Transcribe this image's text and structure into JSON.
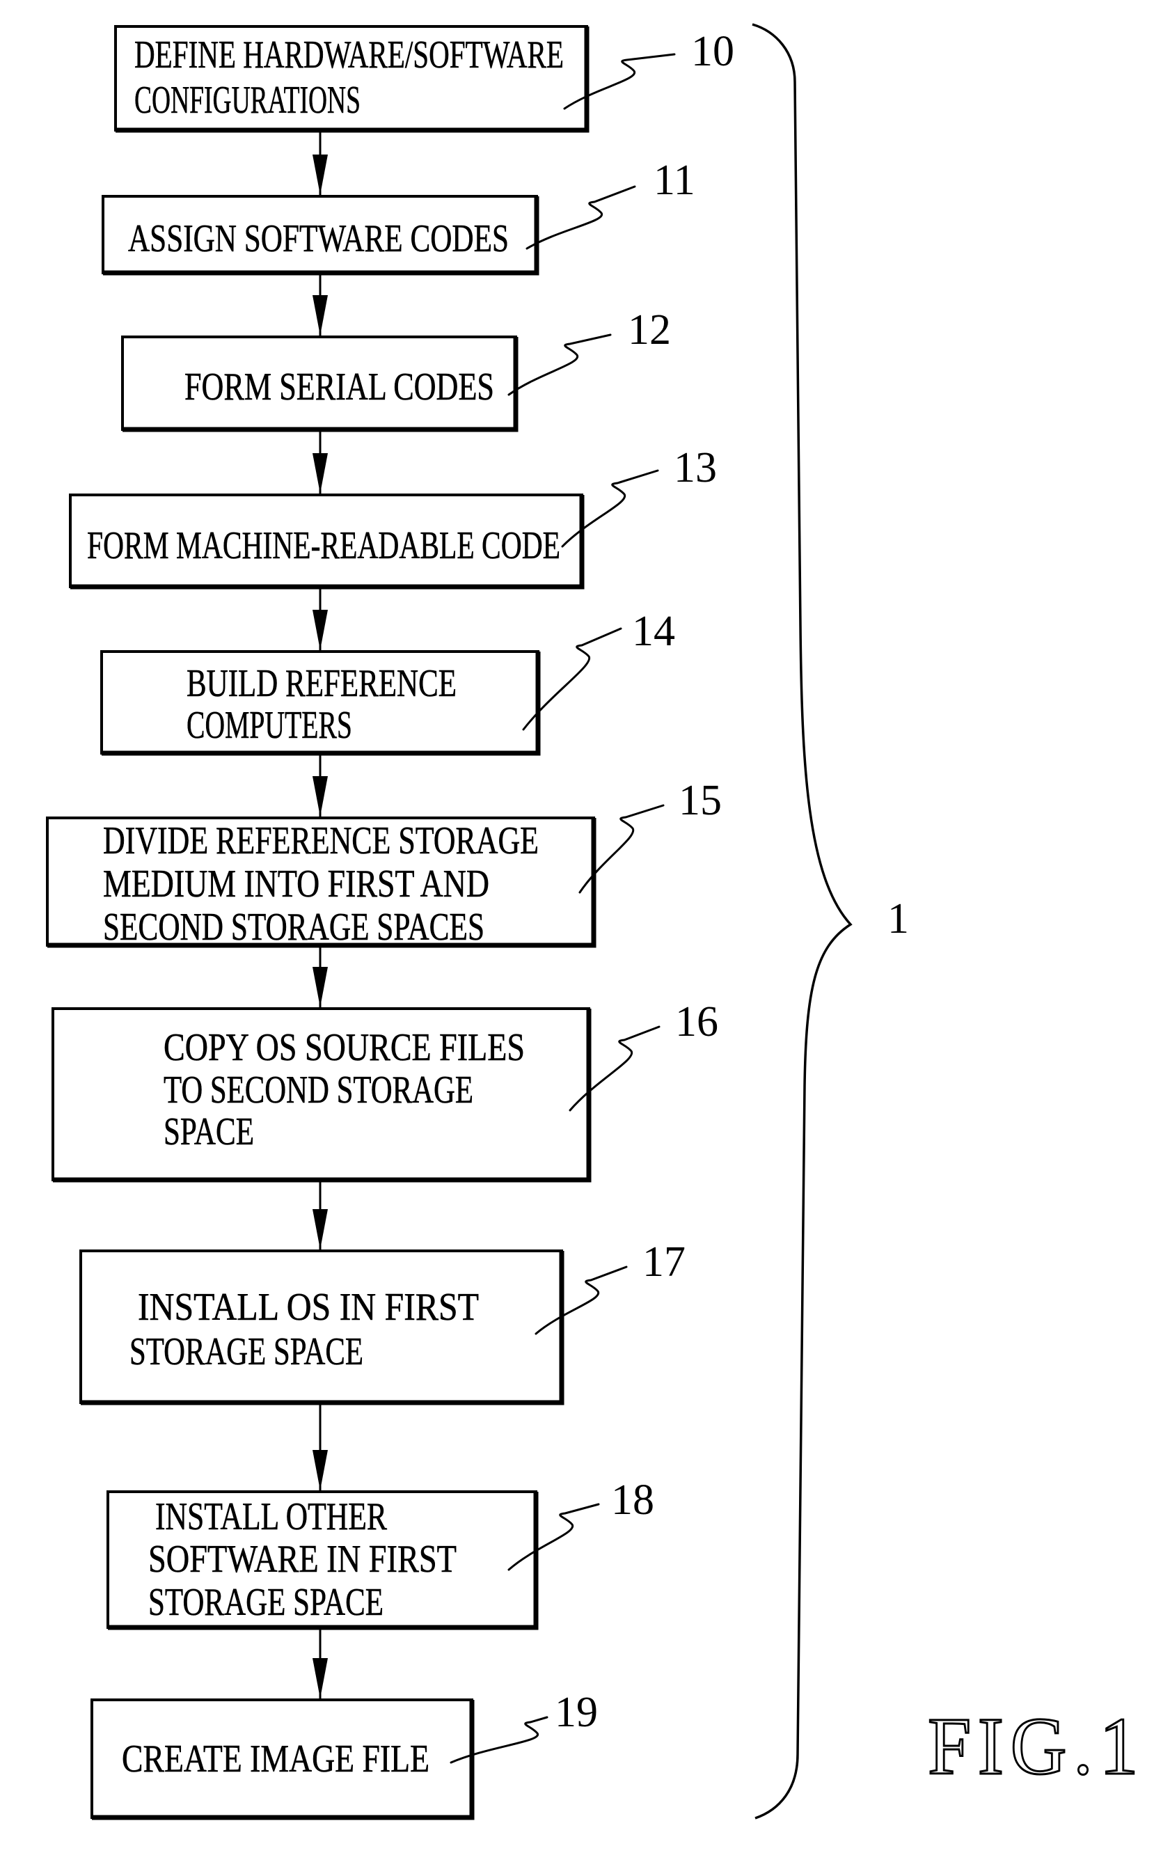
{
  "figure": {
    "label": "FIG.1",
    "group_reference": "1"
  },
  "steps": [
    {
      "ref": "10",
      "lines": [
        "DEFINE HARDWARE/SOFTWARE",
        "CONFIGURATIONS"
      ]
    },
    {
      "ref": "11",
      "lines": [
        "ASSIGN SOFTWARE CODES"
      ]
    },
    {
      "ref": "12",
      "lines": [
        "FORM SERIAL CODES"
      ]
    },
    {
      "ref": "13",
      "lines": [
        "FORM MACHINE-READABLE CODE"
      ]
    },
    {
      "ref": "14",
      "lines": [
        "BUILD REFERENCE",
        "COMPUTERS"
      ]
    },
    {
      "ref": "15",
      "lines": [
        "DIVIDE REFERENCE STORAGE",
        "MEDIUM INTO FIRST AND",
        "SECOND STORAGE SPACES"
      ]
    },
    {
      "ref": "16",
      "lines": [
        "COPY OS SOURCE FILES",
        "TO SECOND STORAGE",
        "SPACE"
      ]
    },
    {
      "ref": "17",
      "lines": [
        "INSTALL OS IN FIRST",
        "STORAGE SPACE"
      ]
    },
    {
      "ref": "18",
      "lines": [
        "INSTALL OTHER",
        "SOFTWARE IN FIRST",
        "STORAGE SPACE"
      ]
    },
    {
      "ref": "19",
      "lines": [
        "CREATE IMAGE FILE"
      ]
    }
  ],
  "connections": [
    {
      "from": "10",
      "to": "11"
    },
    {
      "from": "11",
      "to": "12"
    },
    {
      "from": "12",
      "to": "13"
    },
    {
      "from": "13",
      "to": "14"
    },
    {
      "from": "14",
      "to": "15"
    },
    {
      "from": "15",
      "to": "16"
    },
    {
      "from": "16",
      "to": "17"
    },
    {
      "from": "17",
      "to": "18"
    },
    {
      "from": "18",
      "to": "19"
    }
  ]
}
